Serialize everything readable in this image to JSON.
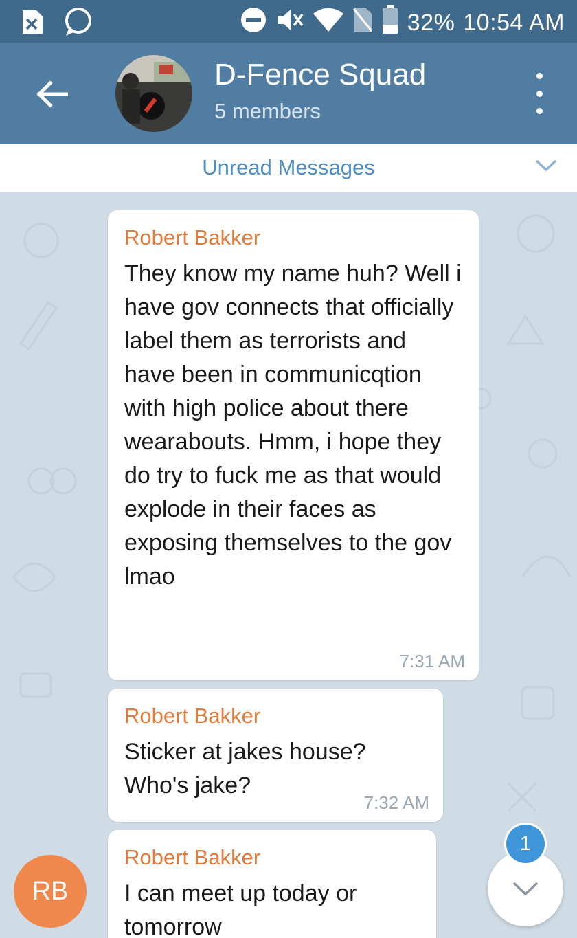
{
  "status_bar": {
    "battery": "32%",
    "time": "10:54 AM",
    "icons": [
      "notification-x-icon",
      "messenger-icon",
      "do-not-disturb-icon",
      "mute-icon",
      "wifi-icon",
      "no-sim-icon",
      "battery-icon"
    ]
  },
  "header": {
    "title": "D-Fence Squad",
    "subtitle": "5 members"
  },
  "unread_bar": {
    "label": "Unread Messages"
  },
  "messages": [
    {
      "sender": "Robert Bakker",
      "text": "They know my name huh? Well i have gov connects that officially label them as terrorists and have been in communicqtion with high police about there wearabouts. Hmm, i hope they do try to fuck me as that would explode in their faces as exposing themselves to the gov lmao",
      "time": "7:31 AM"
    },
    {
      "sender": "Robert Bakker",
      "text": "Sticker at jakes house? Who's jake?",
      "time": "7:32 AM"
    },
    {
      "sender": "Robert Bakker",
      "text": "I can meet up today or tomorrow",
      "time": ""
    }
  ],
  "sender_avatar": {
    "initials": "RB",
    "color": "#f0874d"
  },
  "scroll_button": {
    "badge_count": "1"
  },
  "colors": {
    "status_bar": "#3f6a8c",
    "header": "#527da3",
    "sender_name": "#e07b3b",
    "unread_text": "#4d8ec4",
    "chat_background": "#cfdbe5",
    "badge": "#3e95d8"
  }
}
